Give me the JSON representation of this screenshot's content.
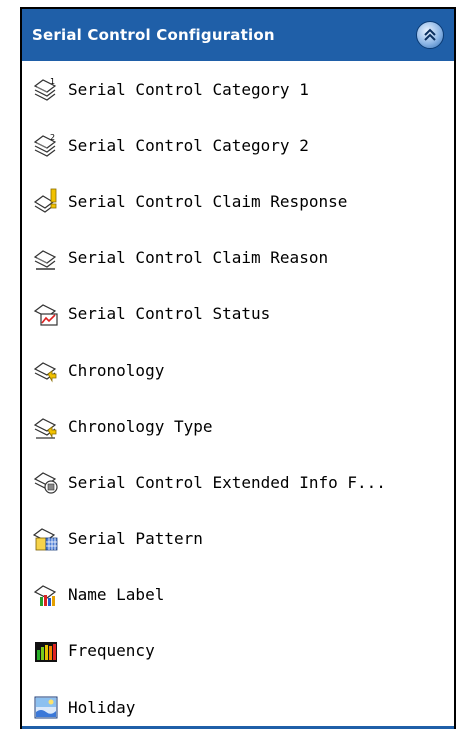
{
  "panel": {
    "title": "Serial Control Configuration",
    "collapse_icon": "double-chevron-up-icon",
    "colors": {
      "header": "#1f5fa8",
      "header_text": "#ffffff",
      "item_text": "#000000"
    },
    "items": [
      {
        "label": "Serial Control Category 1",
        "icon": "category-1-icon"
      },
      {
        "label": "Serial Control Category 2",
        "icon": "category-2-icon"
      },
      {
        "label": "Serial Control Claim Response",
        "icon": "claim-response-icon"
      },
      {
        "label": "Serial Control Claim Reason",
        "icon": "claim-reason-icon"
      },
      {
        "label": "Serial Control Status",
        "icon": "status-icon"
      },
      {
        "label": "Chronology",
        "icon": "chronology-icon"
      },
      {
        "label": "Chronology Type",
        "icon": "chronology-type-icon"
      },
      {
        "label": "Serial Control Extended Info F...",
        "icon": "extended-info-icon"
      },
      {
        "label": "Serial Pattern",
        "icon": "pattern-icon"
      },
      {
        "label": "Name Label",
        "icon": "name-label-icon"
      },
      {
        "label": "Frequency",
        "icon": "frequency-icon"
      },
      {
        "label": "Holiday",
        "icon": "holiday-icon"
      }
    ]
  }
}
